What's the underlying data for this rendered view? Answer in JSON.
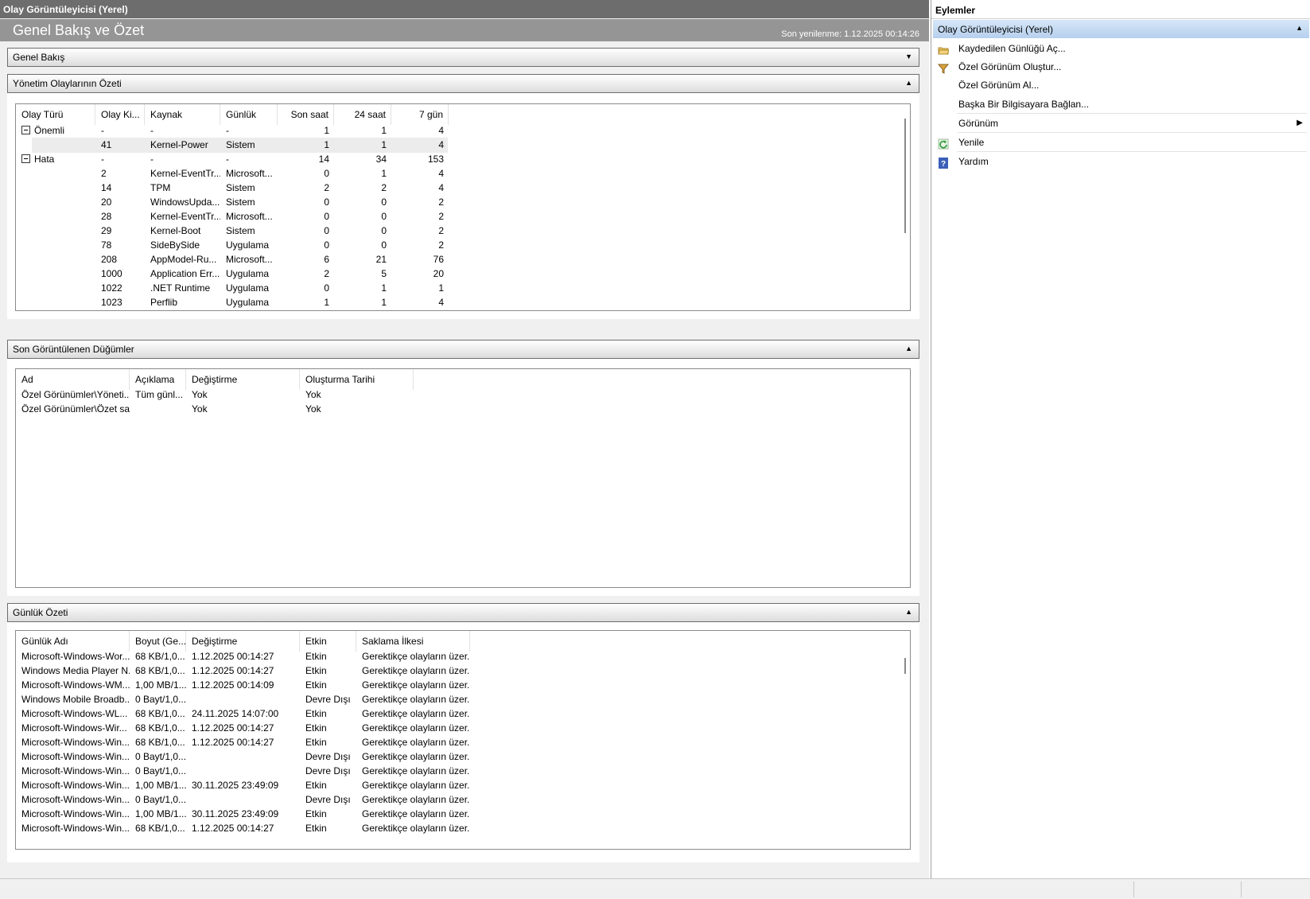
{
  "window": {
    "title": "Olay Görüntüleyicisi (Yerel)"
  },
  "overview": {
    "heading": "Genel Bakış ve Özet",
    "last_refresh": "Son yenilenme: 1.12.2025 00:14:26"
  },
  "sections": {
    "genel_bakis": "Genel Bakış",
    "yonetim": "Yönetim Olaylarının Özeti",
    "son_dugumler": "Son Görüntülenen Düğümler",
    "gunluk_ozeti": "Günlük Özeti"
  },
  "events_table": {
    "headers": [
      "Olay Türü",
      "Olay Ki...",
      "Kaynak",
      "Günlük",
      "Son saat",
      "24 saat",
      "7 gün"
    ],
    "rows": [
      {
        "type": "Önemli",
        "group": true,
        "id": "-",
        "source": "-",
        "log": "-",
        "h1": "1",
        "h24": "1",
        "d7": "4"
      },
      {
        "type": "",
        "group": false,
        "id": "41",
        "source": "Kernel-Power",
        "log": "Sistem",
        "h1": "1",
        "h24": "1",
        "d7": "4",
        "selected": true
      },
      {
        "type": "Hata",
        "group": true,
        "id": "-",
        "source": "-",
        "log": "-",
        "h1": "14",
        "h24": "34",
        "d7": "153"
      },
      {
        "type": "",
        "group": false,
        "id": "2",
        "source": "Kernel-EventTr...",
        "log": "Microsoft...",
        "h1": "0",
        "h24": "1",
        "d7": "4"
      },
      {
        "type": "",
        "group": false,
        "id": "14",
        "source": "TPM",
        "log": "Sistem",
        "h1": "2",
        "h24": "2",
        "d7": "4"
      },
      {
        "type": "",
        "group": false,
        "id": "20",
        "source": "WindowsUpda...",
        "log": "Sistem",
        "h1": "0",
        "h24": "0",
        "d7": "2"
      },
      {
        "type": "",
        "group": false,
        "id": "28",
        "source": "Kernel-EventTr...",
        "log": "Microsoft...",
        "h1": "0",
        "h24": "0",
        "d7": "2"
      },
      {
        "type": "",
        "group": false,
        "id": "29",
        "source": "Kernel-Boot",
        "log": "Sistem",
        "h1": "0",
        "h24": "0",
        "d7": "2"
      },
      {
        "type": "",
        "group": false,
        "id": "78",
        "source": "SideBySide",
        "log": "Uygulama",
        "h1": "0",
        "h24": "0",
        "d7": "2"
      },
      {
        "type": "",
        "group": false,
        "id": "208",
        "source": "AppModel-Ru...",
        "log": "Microsoft...",
        "h1": "6",
        "h24": "21",
        "d7": "76"
      },
      {
        "type": "",
        "group": false,
        "id": "1000",
        "source": "Application Err...",
        "log": "Uygulama",
        "h1": "2",
        "h24": "5",
        "d7": "20"
      },
      {
        "type": "",
        "group": false,
        "id": "1022",
        "source": ".NET Runtime",
        "log": "Uygulama",
        "h1": "0",
        "h24": "1",
        "d7": "1"
      },
      {
        "type": "",
        "group": false,
        "id": "1023",
        "source": "Perflib",
        "log": "Uygulama",
        "h1": "1",
        "h24": "1",
        "d7": "4"
      }
    ]
  },
  "nodes_table": {
    "headers": [
      "Ad",
      "Açıklama",
      "Değiştirme",
      "Oluşturma Tarihi"
    ],
    "rows": [
      [
        "Özel Görünümler\\Yöneti...",
        "Tüm günl...",
        "Yok",
        "Yok"
      ],
      [
        "Özel Görünümler\\Özet sa...",
        "",
        "Yok",
        "Yok"
      ]
    ]
  },
  "logs_table": {
    "headers": [
      "Günlük Adı",
      "Boyut (Ge...",
      "Değiştirme",
      "Etkin",
      "Saklama İlkesi"
    ],
    "rows": [
      [
        "Microsoft-Windows-Wor...",
        "68 KB/1,0...",
        "1.12.2025 00:14:27",
        "Etkin",
        "Gerektikçe olayların üzer..."
      ],
      [
        "Windows Media Player N...",
        "68 KB/1,0...",
        "1.12.2025 00:14:27",
        "Etkin",
        "Gerektikçe olayların üzer..."
      ],
      [
        "Microsoft-Windows-WM...",
        "1,00 MB/1...",
        "1.12.2025 00:14:09",
        "Etkin",
        "Gerektikçe olayların üzer..."
      ],
      [
        "Windows Mobile Broadb...",
        "0 Bayt/1,0...",
        "",
        "Devre Dışı",
        "Gerektikçe olayların üzer..."
      ],
      [
        "Microsoft-Windows-WL...",
        "68 KB/1,0...",
        "24.11.2025 14:07:00",
        "Etkin",
        "Gerektikçe olayların üzer..."
      ],
      [
        "Microsoft-Windows-Wir...",
        "68 KB/1,0...",
        "1.12.2025 00:14:27",
        "Etkin",
        "Gerektikçe olayların üzer..."
      ],
      [
        "Microsoft-Windows-Win...",
        "68 KB/1,0...",
        "1.12.2025 00:14:27",
        "Etkin",
        "Gerektikçe olayların üzer..."
      ],
      [
        "Microsoft-Windows-Win...",
        "0 Bayt/1,0...",
        "",
        "Devre Dışı",
        "Gerektikçe olayların üzer..."
      ],
      [
        "Microsoft-Windows-Win...",
        "0 Bayt/1,0...",
        "",
        "Devre Dışı",
        "Gerektikçe olayların üzer..."
      ],
      [
        "Microsoft-Windows-Win...",
        "1,00 MB/1...",
        "30.11.2025 23:49:09",
        "Etkin",
        "Gerektikçe olayların üzer..."
      ],
      [
        "Microsoft-Windows-Win...",
        "0 Bayt/1,0...",
        "",
        "Devre Dışı",
        "Gerektikçe olayların üzer..."
      ],
      [
        "Microsoft-Windows-Win...",
        "1,00 MB/1...",
        "30.11.2025 23:49:09",
        "Etkin",
        "Gerektikçe olayların üzer..."
      ],
      [
        "Microsoft-Windows-Win...",
        "68 KB/1,0...",
        "1.12.2025 00:14:27",
        "Etkin",
        "Gerektikçe olayların üzer..."
      ]
    ]
  },
  "actions": {
    "title": "Eylemler",
    "group": "Olay Görüntüleyicisi (Yerel)",
    "items": [
      {
        "label": "Kaydedilen Günlüğü Aç...",
        "icon": "open-folder-icon"
      },
      {
        "label": "Özel Görünüm Oluştur...",
        "icon": "filter-icon"
      },
      {
        "label": "Özel Görünüm Al...",
        "icon": ""
      },
      {
        "label": "Başka Bir Bilgisayara Bağlan...",
        "icon": ""
      },
      {
        "label": "Görünüm",
        "icon": "",
        "submenu": true
      },
      {
        "label": "Yenile",
        "icon": "refresh-icon"
      },
      {
        "label": "Yardım",
        "icon": "help-icon"
      }
    ]
  },
  "colors": {
    "accent_group": "#b6d0ee",
    "titlebar": "#6d6d6d",
    "overview_bar": "#959595"
  }
}
